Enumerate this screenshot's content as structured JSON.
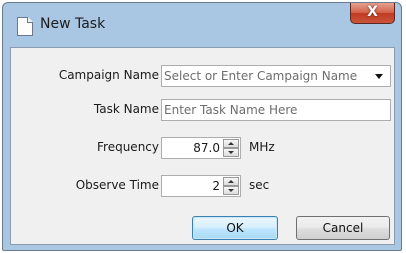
{
  "window": {
    "title": "New Task",
    "close_label": "X"
  },
  "form": {
    "campaign": {
      "label": "Campaign Name",
      "placeholder": "Select or Enter Campaign Name"
    },
    "task": {
      "label": "Task Name",
      "placeholder": "Enter Task Name Here"
    },
    "frequency": {
      "label": "Frequency",
      "value": "87.0",
      "unit": "MHz"
    },
    "observe_time": {
      "label": "Observe Time",
      "value": "2",
      "unit": "sec"
    }
  },
  "buttons": {
    "ok": "OK",
    "cancel": "Cancel"
  }
}
